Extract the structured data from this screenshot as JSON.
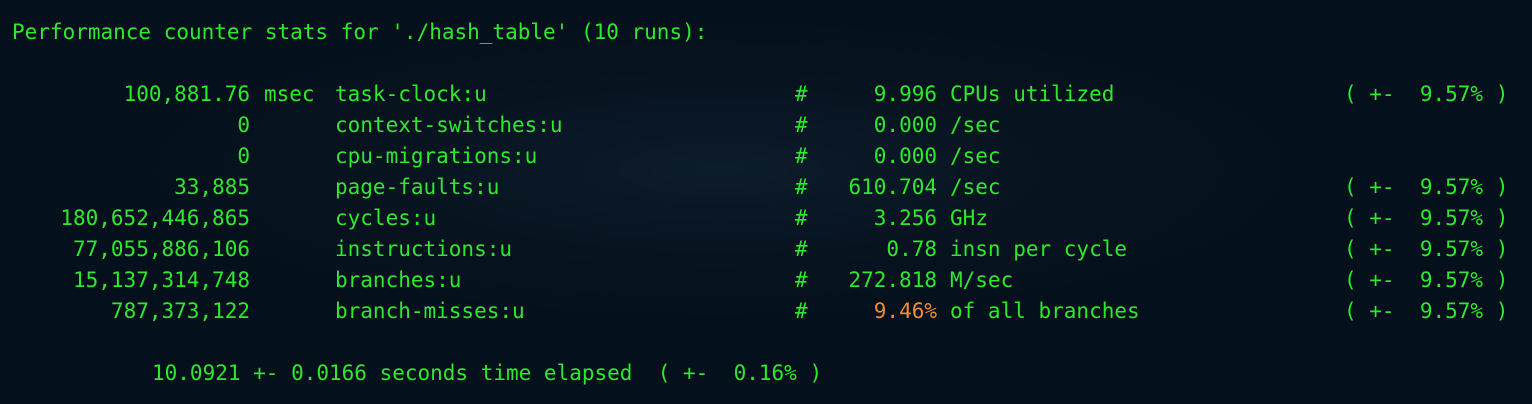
{
  "header": "Performance counter stats for './hash_table' (10 runs):",
  "rows": [
    {
      "value": "100,881.76",
      "unit": "msec",
      "event": "task-clock:u",
      "hash": "#",
      "metric": "9.996",
      "desc": "CPUs utilized",
      "variance": "( +-  9.57% )"
    },
    {
      "value": "0",
      "unit": "",
      "event": "context-switches:u",
      "hash": "#",
      "metric": "0.000",
      "desc": "/sec",
      "variance": ""
    },
    {
      "value": "0",
      "unit": "",
      "event": "cpu-migrations:u",
      "hash": "#",
      "metric": "0.000",
      "desc": "/sec",
      "variance": ""
    },
    {
      "value": "33,885",
      "unit": "",
      "event": "page-faults:u",
      "hash": "#",
      "metric": "610.704",
      "desc": "/sec",
      "variance": "( +-  9.57% )"
    },
    {
      "value": "180,652,446,865",
      "unit": "",
      "event": "cycles:u",
      "hash": "#",
      "metric": "3.256",
      "desc": "GHz",
      "variance": "( +-  9.57% )"
    },
    {
      "value": "77,055,886,106",
      "unit": "",
      "event": "instructions:u",
      "hash": "#",
      "metric": "0.78",
      "desc": "insn per cycle",
      "variance": "( +-  9.57% )"
    },
    {
      "value": "15,137,314,748",
      "unit": "",
      "event": "branches:u",
      "hash": "#",
      "metric": "272.818",
      "desc": "M/sec",
      "variance": "( +-  9.57% )"
    },
    {
      "value": "787,373,122",
      "unit": "",
      "event": "branch-misses:u",
      "hash": "#",
      "metric": "9.46%",
      "desc": "of all branches",
      "variance": "( +-  9.57% )"
    }
  ],
  "footer": "10.0921 +- 0.0166 seconds time elapsed  ( +-  0.16% )",
  "colors": {
    "background": "#04101c",
    "text": "#2ee82e",
    "highlight": "#f08c2c"
  }
}
